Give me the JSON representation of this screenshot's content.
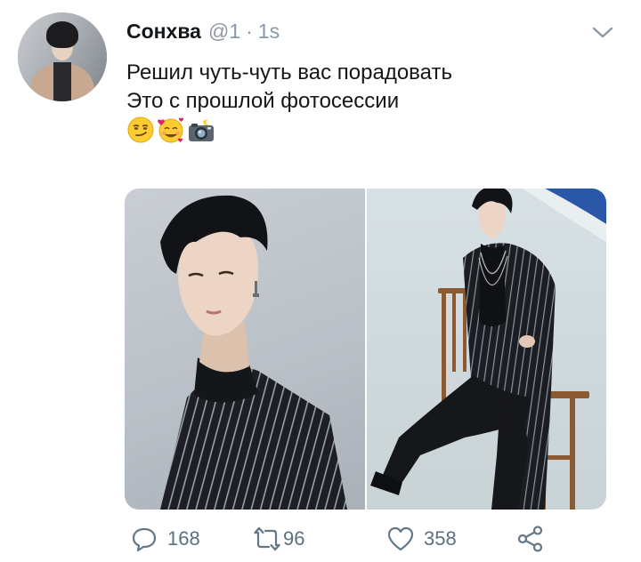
{
  "tweet": {
    "author_name": "Сонхва",
    "author_handle": "@1",
    "separator": "·",
    "timestamp": "1s",
    "text_lines": [
      "Решил чуть-чуть вас порадовать",
      "Это с прошлой фотосессии"
    ],
    "emojis": [
      "smirking-face",
      "smiling-face-with-hearts",
      "camera-with-flash"
    ]
  },
  "actions": {
    "reply_count": "168",
    "retweet_count": "96",
    "like_count": "358"
  },
  "colors": {
    "text": "#14171a",
    "muted": "#8b98a5",
    "action_icon": "#657786"
  }
}
